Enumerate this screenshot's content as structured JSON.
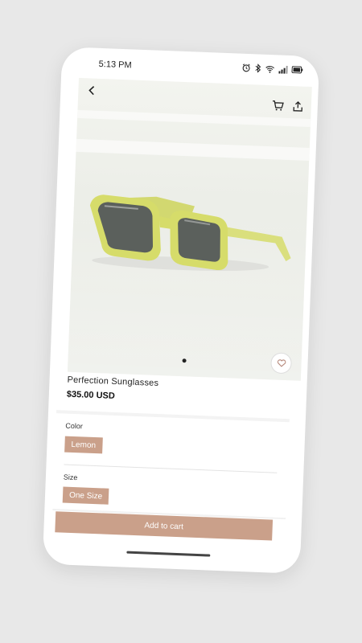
{
  "status_bar": {
    "time": "5:13 PM"
  },
  "product": {
    "name": "Perfection Sunglasses",
    "price": "$35.00 USD"
  },
  "options": {
    "color_label": "Color",
    "color_value": "Lemon",
    "size_label": "Size",
    "size_value": "One Size"
  },
  "actions": {
    "add_to_cart_label": "Add to cart"
  },
  "colors": {
    "accent": "#caa08a",
    "frame": "#d6dc6a",
    "lens": "#5b605c"
  },
  "icons": [
    "back-icon",
    "cart-icon",
    "share-icon",
    "heart-icon",
    "alarm-icon",
    "bluetooth-icon",
    "wifi-icon",
    "signal-icon",
    "battery-icon"
  ],
  "carousel": {
    "page_count": 1,
    "current_page": 1
  }
}
